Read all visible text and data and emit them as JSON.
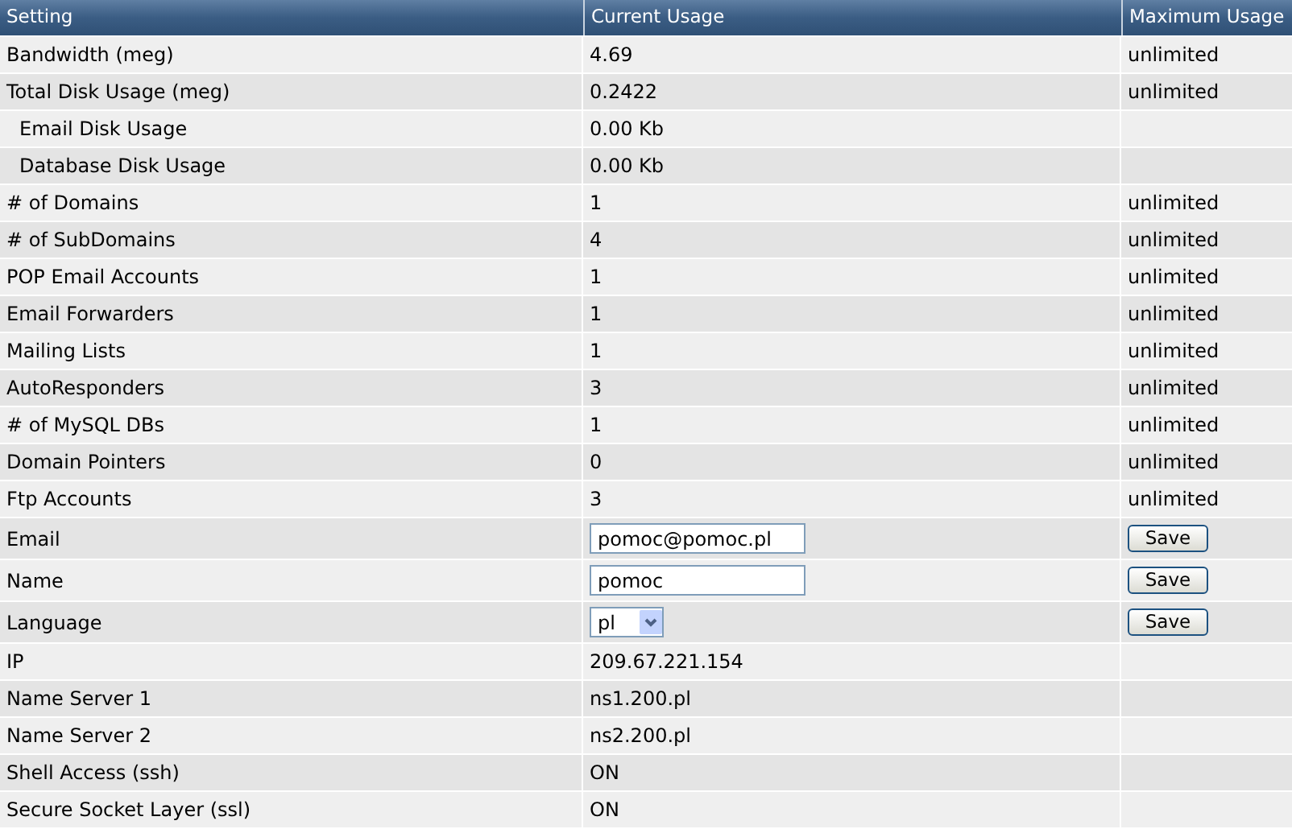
{
  "table": {
    "columns": [
      "Setting",
      "Current Usage",
      "Maximum Usage"
    ],
    "rows": [
      {
        "kind": "text",
        "setting": "Bandwidth (meg)",
        "current": "4.69",
        "maximum": "unlimited"
      },
      {
        "kind": "text",
        "setting": "Total Disk Usage (meg)",
        "current": "0.2422",
        "maximum": "unlimited",
        "children": [
          {
            "kind": "text",
            "setting": "Email Disk Usage",
            "current": "0.00 Kb"
          },
          {
            "kind": "text",
            "setting": "Database Disk Usage",
            "current": "0.00 Kb"
          }
        ]
      },
      {
        "kind": "text",
        "setting": "# of Domains",
        "current": "1",
        "maximum": "unlimited"
      },
      {
        "kind": "text",
        "setting": "# of SubDomains",
        "current": "4",
        "maximum": "unlimited"
      },
      {
        "kind": "text",
        "setting": "POP Email Accounts",
        "current": "1",
        "maximum": "unlimited"
      },
      {
        "kind": "text",
        "setting": "Email Forwarders",
        "current": "1",
        "maximum": "unlimited"
      },
      {
        "kind": "text",
        "setting": "Mailing Lists",
        "current": "1",
        "maximum": "unlimited"
      },
      {
        "kind": "text",
        "setting": "AutoResponders",
        "current": "3",
        "maximum": "unlimited"
      },
      {
        "kind": "text",
        "setting": "# of MySQL DBs",
        "current": "1",
        "maximum": "unlimited"
      },
      {
        "kind": "text",
        "setting": "Domain Pointers",
        "current": "0",
        "maximum": "unlimited"
      },
      {
        "kind": "text",
        "setting": "Ftp Accounts",
        "current": "3",
        "maximum": "unlimited"
      },
      {
        "kind": "input",
        "setting": "Email",
        "current": "pomoc@pomoc.pl",
        "button": "Save"
      },
      {
        "kind": "input",
        "setting": "Name",
        "current": "pomoc",
        "button": "Save"
      },
      {
        "kind": "select",
        "setting": "Language",
        "current": "pl",
        "button": "Save"
      },
      {
        "kind": "text",
        "setting": "IP",
        "current": "209.67.221.154"
      },
      {
        "kind": "text",
        "setting": "Name Server 1",
        "current": "ns1.200.pl"
      },
      {
        "kind": "text",
        "setting": "Name Server 2",
        "current": "ns2.200.pl"
      },
      {
        "kind": "text",
        "setting": "Shell Access (ssh)",
        "current": "ON"
      },
      {
        "kind": "text",
        "setting": "Secure Socket Layer (ssl)",
        "current": "ON"
      }
    ]
  }
}
